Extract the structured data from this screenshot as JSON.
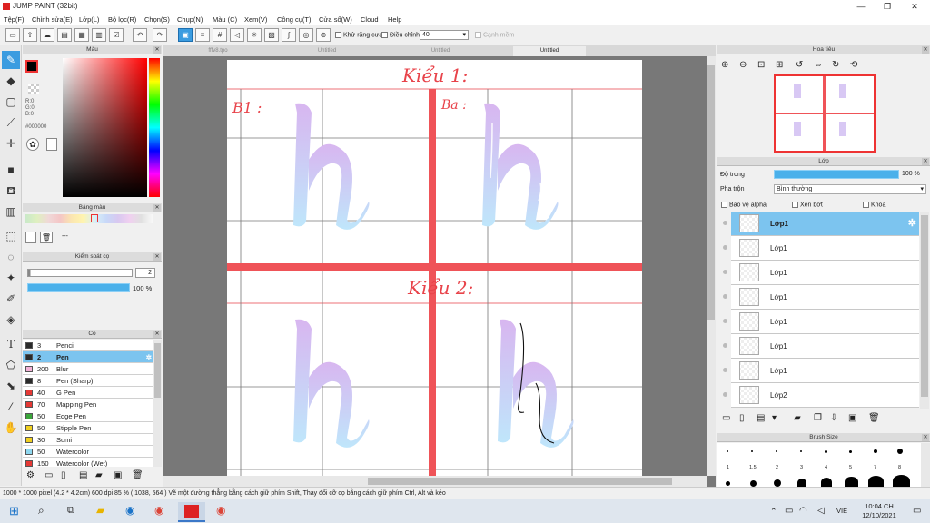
{
  "window": {
    "title": "JUMP PAINT (32bit)",
    "min": "—",
    "max": "❐",
    "close": "✕"
  },
  "menu": [
    "Tệp(F)",
    "Chỉnh sửa(E)",
    "Lớp(L)",
    "Bộ lọc(R)",
    "Chọn(S)",
    "Chụp(N)",
    "Màu (C)",
    "Xem(V)",
    "Công cụ(T)",
    "Cửa sổ(W)",
    "Cloud",
    "Help"
  ],
  "toolbar": {
    "antialias_label": "Khử răng cưa",
    "adjust_label": "Điều chỉnh",
    "adjust_value": "40",
    "snap_label": "Cạnh mềm"
  },
  "tabs": [
    "fffv8.tpo",
    "Untitled",
    "Untitled",
    "Untitled"
  ],
  "color_panel": {
    "title": "Màu",
    "r": "R:0",
    "g": "G:0",
    "b": "B:0",
    "hex": "#000000"
  },
  "palette_panel": {
    "title": "Bảng màu",
    "more": "---"
  },
  "size_panel": {
    "title": "Kiểm soát cọ",
    "size_value": "2",
    "opacity_value": "100 %"
  },
  "brush_panel": {
    "title": "Cọ",
    "items": [
      {
        "size": "3",
        "name": "Pencil",
        "color": "#2a2a2a"
      },
      {
        "size": "2",
        "name": "Pen",
        "color": "#2a2a2a"
      },
      {
        "size": "200",
        "name": "Blur",
        "color": "#f4b2d8"
      },
      {
        "size": "8",
        "name": "Pen (Sharp)",
        "color": "#2a2a2a"
      },
      {
        "size": "40",
        "name": "G Pen",
        "color": "#e53935"
      },
      {
        "size": "70",
        "name": "Mapping Pen",
        "color": "#e53935"
      },
      {
        "size": "50",
        "name": "Edge Pen",
        "color": "#3aa63a"
      },
      {
        "size": "50",
        "name": "Stipple Pen",
        "color": "#f0d020"
      },
      {
        "size": "30",
        "name": "Sumi",
        "color": "#f0d020"
      },
      {
        "size": "50",
        "name": "Watercolor",
        "color": "#8fd8f0"
      },
      {
        "size": "150",
        "name": "Watercolor (Wet)",
        "color": "#e53935"
      }
    ]
  },
  "canvas_text": {
    "style1": "Kiểu 1:",
    "b1": "B1 :",
    "ba": "Ba :",
    "style2": "Kiểu 2:"
  },
  "navigator": {
    "title": "Hoa tiêu"
  },
  "layers_panel": {
    "title": "Lớp",
    "opacity_label": "Độ trong",
    "opacity_value": "100 %",
    "blend_label": "Pha trộn",
    "blend_value": "Bình thường",
    "protect_alpha": "Bảo vệ alpha",
    "clipping": "Xén bớt",
    "lock": "Khóa",
    "layers": [
      "Lớp1",
      "Lớp1",
      "Lớp1",
      "Lớp1",
      "Lớp1",
      "Lớp1",
      "Lớp1",
      "Lớp2"
    ]
  },
  "brush_size_panel": {
    "title": "Brush Size",
    "labels": [
      "1",
      "1.5",
      "2",
      "3",
      "4",
      "5",
      "7",
      "8"
    ]
  },
  "status": {
    "text": "1000 * 1000 pixel   (4.2 * 4.2cm)   600 dpi   85 %   ( 1038, 564 )   Vẽ một đường thẳng bằng cách giữ phím Shift, Thay đổi cỡ cọ bằng cách giữ phím Ctrl, Alt và kéo"
  },
  "taskbar": {
    "lang": "VIE",
    "time": "10:04 CH",
    "date": "12/10/2021"
  }
}
